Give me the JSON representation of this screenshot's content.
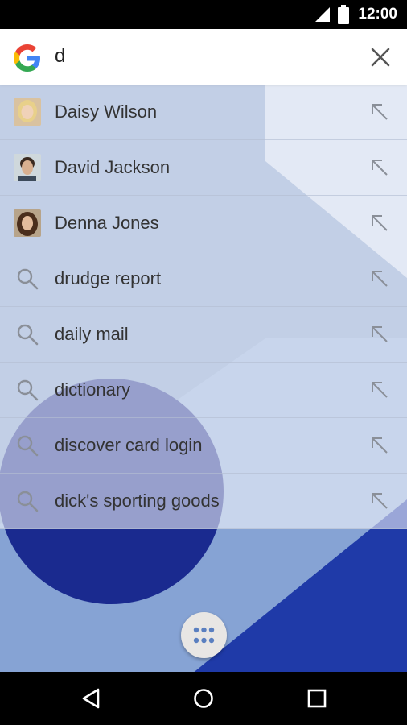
{
  "status_bar": {
    "time": "12:00",
    "icons": [
      "signal-icon",
      "battery-icon"
    ]
  },
  "search": {
    "query": "d",
    "logo": "google-logo",
    "clear_icon": "close-icon"
  },
  "contact_suggestions": [
    {
      "name": "Daisy Wilson",
      "avatar_bg": "#d9c2a0",
      "hair": "#e8d08a",
      "skin": "#f0d2b8"
    },
    {
      "name": "David Jackson",
      "avatar_bg": "#cfd8dc",
      "hair": "#3a2a20",
      "skin": "#d8b090"
    },
    {
      "name": "Denna Jones",
      "avatar_bg": "#b7a48a",
      "hair": "#4a2e1c",
      "skin": "#e3bc9c"
    }
  ],
  "query_suggestions": [
    "drudge report",
    "daily mail",
    "dictionary",
    "discover card login",
    "dick's sporting goods"
  ],
  "icons": {
    "row_search": "search-icon",
    "row_arrow": "arrow-up-left-icon",
    "app_drawer": "apps-grid-icon"
  },
  "nav_bar": {
    "back": "back-icon",
    "home": "home-icon",
    "recents": "recents-icon"
  },
  "colors": {
    "wallpaper_dark": "#1a2a8f",
    "wallpaper_light": "#dce7f5",
    "divider": "#b4bed2"
  }
}
